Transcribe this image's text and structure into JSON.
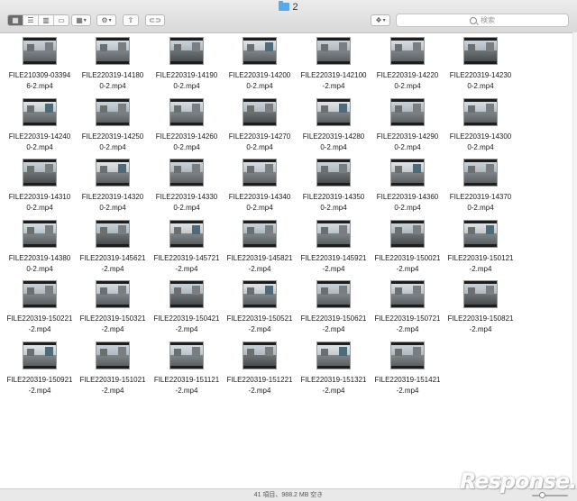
{
  "window": {
    "title": "2"
  },
  "toolbar": {
    "view_modes": [
      "icon-view",
      "list-view",
      "column-view",
      "cover-flow-view"
    ],
    "search_placeholder": "検索"
  },
  "files": [
    {
      "line1": "FILE210309-03394",
      "line2": "6-2.mp4"
    },
    {
      "line1": "FILE220319-14180",
      "line2": "0-2.mp4"
    },
    {
      "line1": "FILE220319-14190",
      "line2": "0-2.mp4"
    },
    {
      "line1": "FILE220319-14200",
      "line2": "0-2.mp4"
    },
    {
      "line1": "FILE220319-142100",
      "line2": "-2.mp4"
    },
    {
      "line1": "FILE220319-14220",
      "line2": "0-2.mp4"
    },
    {
      "line1": "FILE220319-14230",
      "line2": "0-2.mp4"
    },
    {
      "line1": "FILE220319-14240",
      "line2": "0-2.mp4"
    },
    {
      "line1": "FILE220319-14250",
      "line2": "0-2.mp4"
    },
    {
      "line1": "FILE220319-14260",
      "line2": "0-2.mp4"
    },
    {
      "line1": "FILE220319-14270",
      "line2": "0-2.mp4"
    },
    {
      "line1": "FILE220319-14280",
      "line2": "0-2.mp4"
    },
    {
      "line1": "FILE220319-14290",
      "line2": "0-2.mp4"
    },
    {
      "line1": "FILE220319-14300",
      "line2": "0-2.mp4"
    },
    {
      "line1": "FILE220319-14310",
      "line2": "0-2.mp4"
    },
    {
      "line1": "FILE220319-14320",
      "line2": "0-2.mp4"
    },
    {
      "line1": "FILE220319-14330",
      "line2": "0-2.mp4"
    },
    {
      "line1": "FILE220319-14340",
      "line2": "0-2.mp4"
    },
    {
      "line1": "FILE220319-14350",
      "line2": "0-2.mp4"
    },
    {
      "line1": "FILE220319-14360",
      "line2": "0-2.mp4"
    },
    {
      "line1": "FILE220319-14370",
      "line2": "0-2.mp4"
    },
    {
      "line1": "FILE220319-14380",
      "line2": "0-2.mp4"
    },
    {
      "line1": "FILE220319-145621",
      "line2": "-2.mp4"
    },
    {
      "line1": "FILE220319-145721",
      "line2": "-2.mp4"
    },
    {
      "line1": "FILE220319-145821",
      "line2": "-2.mp4"
    },
    {
      "line1": "FILE220319-145921",
      "line2": "-2.mp4"
    },
    {
      "line1": "FILE220319-150021",
      "line2": "-2.mp4"
    },
    {
      "line1": "FILE220319-150121",
      "line2": "-2.mp4"
    },
    {
      "line1": "FILE220319-150221",
      "line2": "-2.mp4"
    },
    {
      "line1": "FILE220319-150321",
      "line2": "-2.mp4"
    },
    {
      "line1": "FILE220319-150421",
      "line2": "-2.mp4"
    },
    {
      "line1": "FILE220319-150521",
      "line2": "-2.mp4"
    },
    {
      "line1": "FILE220319-150621",
      "line2": "-2.mp4"
    },
    {
      "line1": "FILE220319-150721",
      "line2": "-2.mp4"
    },
    {
      "line1": "FILE220319-150821",
      "line2": "-2.mp4"
    },
    {
      "line1": "FILE220319-150921",
      "line2": "-2.mp4"
    },
    {
      "line1": "FILE220319-151021",
      "line2": "-2.mp4"
    },
    {
      "line1": "FILE220319-151121",
      "line2": "-2.mp4"
    },
    {
      "line1": "FILE220319-151221",
      "line2": "-2.mp4"
    },
    {
      "line1": "FILE220319-151321",
      "line2": "-2.mp4"
    },
    {
      "line1": "FILE220319-151421",
      "line2": "-2.mp4"
    }
  ],
  "status": {
    "text": "41 項目、988.2 MB 空き"
  },
  "watermark": {
    "text": "Response."
  }
}
